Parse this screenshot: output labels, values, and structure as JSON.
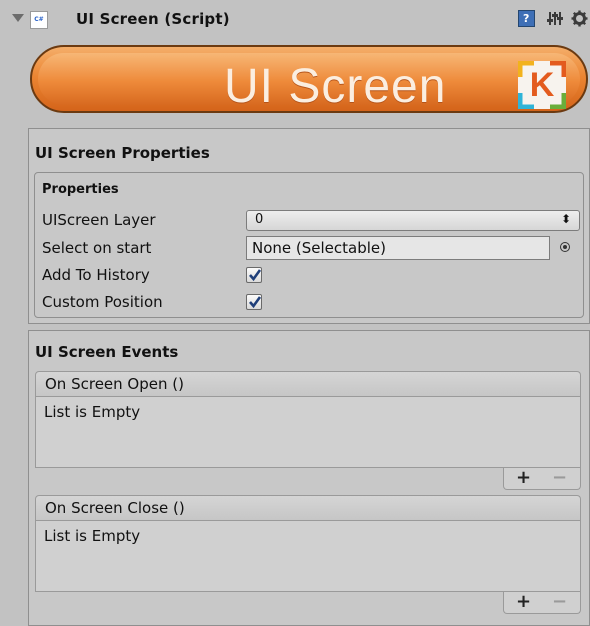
{
  "header": {
    "title": "UI Screen (Script)",
    "script_icon": "cs-script-icon",
    "collapse_icon": "triangle-down-icon",
    "help_icon": "help-book-icon",
    "presets_icon": "sliders-icon",
    "settings_icon": "gear-icon"
  },
  "banner": {
    "text": "UI Screen",
    "logo_letter": "K"
  },
  "properties_section": {
    "title": "UI Screen Properties",
    "group_title": "Properties",
    "fields": {
      "layer_label": "UIScreen Layer",
      "layer_value": "0",
      "select_label": "Select on start",
      "select_value": "None (Selectable)",
      "history_label": "Add To History",
      "history_checked": true,
      "position_label": "Custom Position",
      "position_checked": true
    }
  },
  "events_section": {
    "title": "UI Screen Events",
    "events": [
      {
        "name": "On Screen Open ()",
        "body": "List is Empty",
        "add": "+",
        "remove": "−"
      },
      {
        "name": "On Screen Close ()",
        "body": "List is Empty",
        "add": "+",
        "remove": "−"
      }
    ]
  },
  "colors": {
    "panel_bg": "#c2c2c2",
    "banner_orange": "#ec8633",
    "checkmark": "#1f3f7a"
  }
}
